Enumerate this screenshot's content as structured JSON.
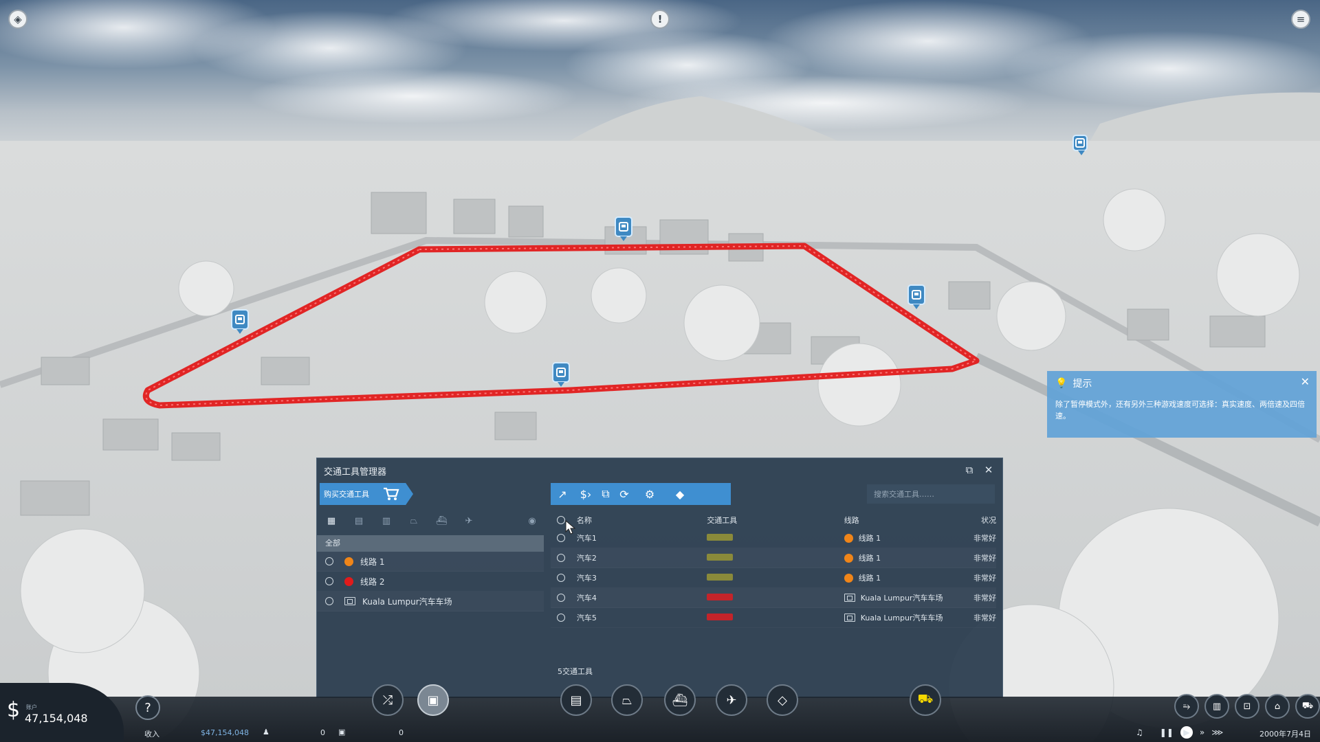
{
  "manager": {
    "title": "交通工具管理器",
    "buy_label": "购买交通工具",
    "search_placeholder": "搜索交通工具……",
    "group_all": "全部",
    "lines": [
      {
        "name": "线路 1",
        "color": "#f08519"
      },
      {
        "name": "线路 2",
        "color": "#e11b1b"
      },
      {
        "name": "Kuala Lumpur汽车车场",
        "depot": true
      }
    ],
    "columns": {
      "name": "名称",
      "vehicle": "交通工具",
      "line": "线路",
      "status": "状况"
    },
    "vehicles": [
      {
        "name": "汽车1",
        "line": "线路 1",
        "status": "非常好",
        "line_color": "#f08519",
        "vehicle_color": "#8a8a3a"
      },
      {
        "name": "汽车2",
        "line": "线路 1",
        "status": "非常好",
        "line_color": "#f08519",
        "vehicle_color": "#8a8a3a"
      },
      {
        "name": "汽车3",
        "line": "线路 1",
        "status": "非常好",
        "line_color": "#f08519",
        "vehicle_color": "#8a8a3a"
      },
      {
        "name": "汽车4",
        "line": "Kuala Lumpur汽车车场",
        "status": "非常好",
        "depot": true,
        "vehicle_color": "#c4242a"
      },
      {
        "name": "汽车5",
        "line": "Kuala Lumpur汽车车场",
        "status": "非常好",
        "depot": true,
        "vehicle_color": "#c4242a"
      }
    ],
    "count_label": "5交通工具"
  },
  "tip": {
    "title": "提示",
    "text": "除了暂停模式外，还有另外三种游戏速度可选择：真实速度、两倍速及四倍速。"
  },
  "hud": {
    "account_label": "账户",
    "money": "47,154,048",
    "income_label": "收入",
    "income_value": "$47,154,048",
    "passengers_value": "0",
    "cargo_value": "0",
    "date": "2000年7月4日"
  },
  "colors": {
    "accent": "#3f8fd1",
    "route": "#e11b1b",
    "tip_bg": "#61a2d7"
  }
}
